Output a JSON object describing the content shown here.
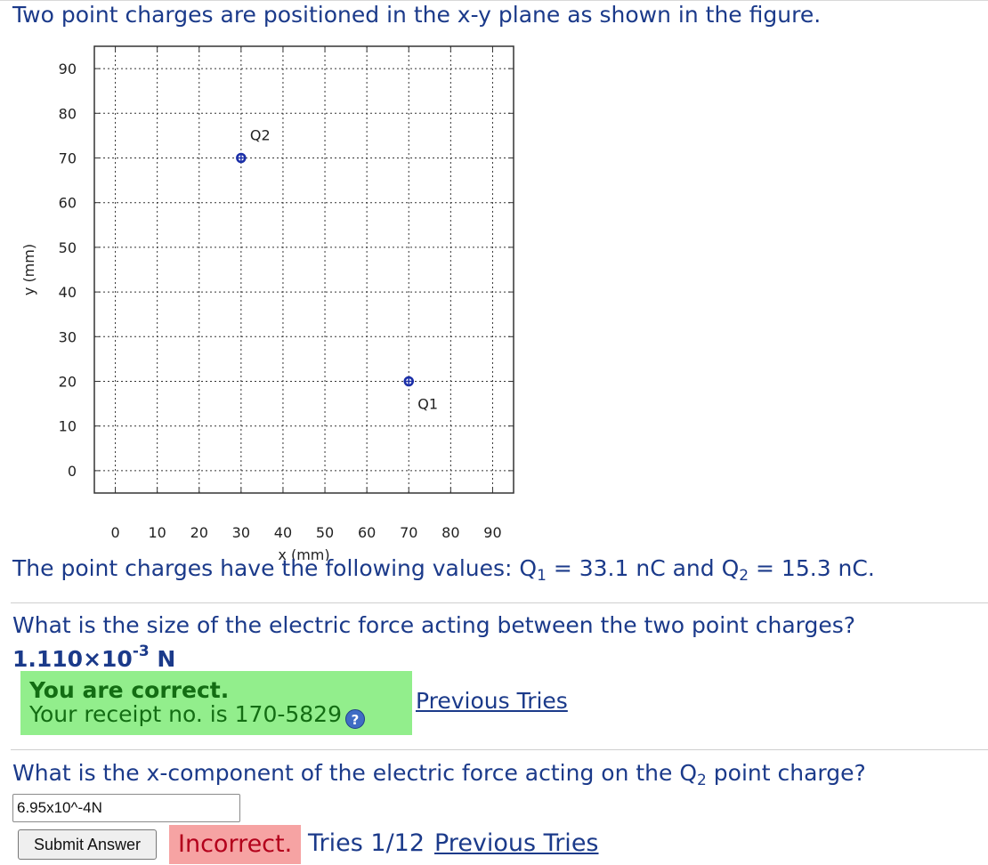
{
  "problem": {
    "intro": "Two point charges are positioned in the x-y plane as shown in the figure.",
    "values_prefix": "The point charges have the following values: Q",
    "q1_sub": "1",
    "q1_value": " = 33.1 nC and Q",
    "q2_sub": "2",
    "q2_value": " = 15.3 nC."
  },
  "chart_data": {
    "type": "scatter",
    "xlabel": "x (mm)",
    "ylabel": "y (mm)",
    "xlim": [
      -5,
      95
    ],
    "ylim": [
      -5,
      95
    ],
    "xticks": [
      0,
      10,
      20,
      30,
      40,
      50,
      60,
      70,
      80,
      90
    ],
    "yticks": [
      0,
      10,
      20,
      30,
      40,
      50,
      60,
      70,
      80,
      90
    ],
    "grid": true,
    "marker_color": "#1b2fa8",
    "points": [
      {
        "label": "Q1",
        "x": 70,
        "y": 20
      },
      {
        "label": "Q2",
        "x": 30,
        "y": 70
      }
    ]
  },
  "question1": {
    "text": "What is the size of the electric force acting between the two point charges?",
    "answer_mantissa": "1.110×10",
    "answer_exponent": "-3",
    "answer_unit": " N",
    "status_title": "You are correct.",
    "receipt_text": "Your receipt no. is 170-5829",
    "help_icon_glyph": "?",
    "previous_tries_label": "Previous Tries"
  },
  "question2": {
    "text_prefix": "What is the x-component of the electric force acting on the Q",
    "text_sub": "2",
    "text_suffix": " point charge?",
    "input_value": "6.95x10^-4N",
    "submit_label": "Submit Answer",
    "status": "Incorrect.",
    "tries": "Tries 1/12",
    "previous_tries_label": "Previous Tries"
  },
  "colors": {
    "text": "#1b3a8a",
    "correct_bg": "#92ee8c",
    "correct_text": "#136d13",
    "incorrect_bg": "#f6a3a3",
    "incorrect_text": "#b3001b"
  }
}
